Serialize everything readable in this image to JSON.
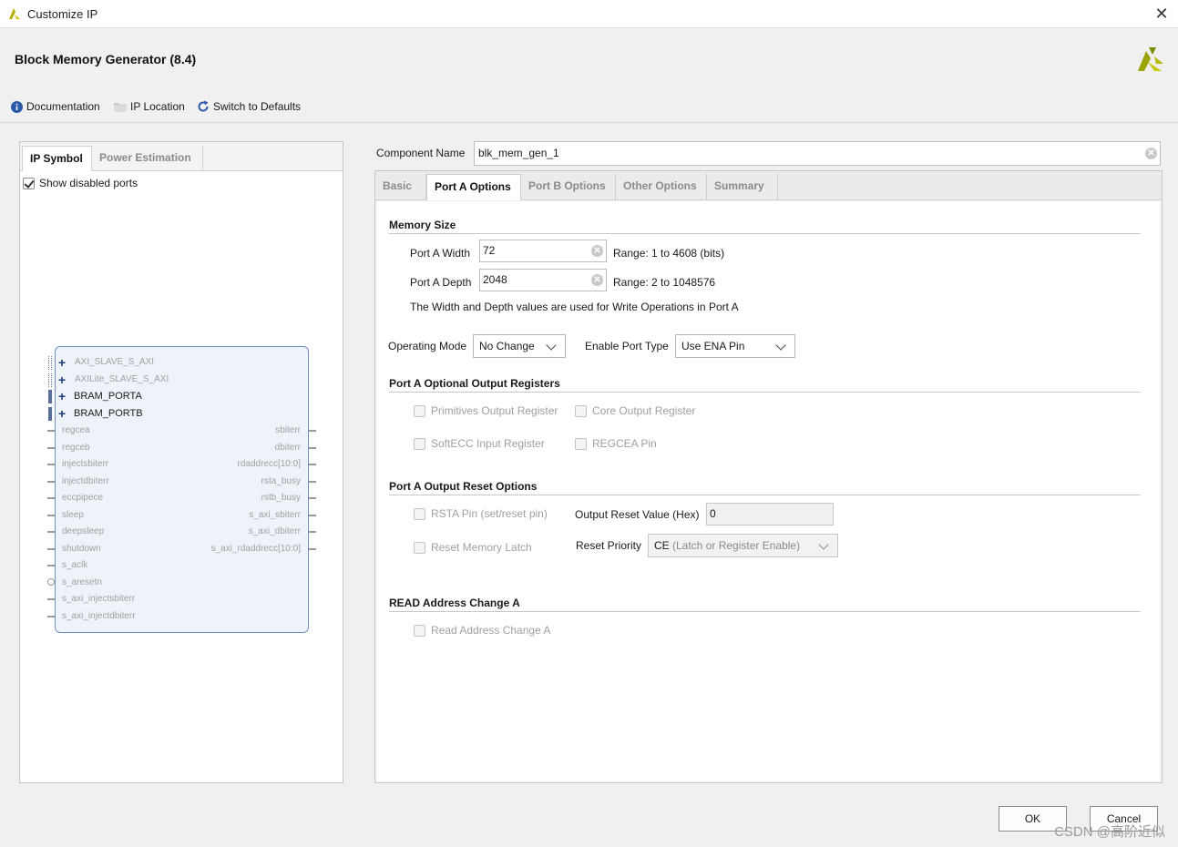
{
  "window": {
    "title": "Customize IP"
  },
  "header": {
    "ip_title": "Block Memory Generator (8.4)",
    "links": {
      "documentation": "Documentation",
      "ip_location": "IP Location",
      "switch_defaults": "Switch to Defaults"
    }
  },
  "left": {
    "tabs": [
      "IP Symbol",
      "Power Estimation"
    ],
    "show_disabled_ports": "Show disabled ports",
    "bus_ports": [
      "AXI_SLAVE_S_AXI",
      "AXILite_SLAVE_S_AXI",
      "BRAM_PORTA",
      "BRAM_PORTB"
    ],
    "left_ports": [
      "regcea",
      "regceb",
      "injectsbiterr",
      "injectdbiterr",
      "eccpipece",
      "sleep",
      "deepsleep",
      "shutdown",
      "s_aclk",
      "s_aresetn",
      "s_axi_injectsbiterr",
      "s_axi_injectdbiterr"
    ],
    "right_ports": [
      "sbiterr",
      "dbiterr",
      "rdaddrecc[10:0]",
      "rsta_busy",
      "rstb_busy",
      "s_axi_sbiterr",
      "s_axi_dbiterr",
      "s_axi_rdaddrecc[10:0]"
    ]
  },
  "component": {
    "label": "Component Name",
    "value": "blk_mem_gen_1"
  },
  "tabs": [
    "Basic",
    "Port A Options",
    "Port B Options",
    "Other Options",
    "Summary"
  ],
  "memory_size": {
    "title": "Memory Size",
    "width_label": "Port A Width",
    "width_value": "72",
    "width_range": "Range: 1 to 4608 (bits)",
    "depth_label": "Port A Depth",
    "depth_value": "2048",
    "depth_range": "Range: 2 to 1048576",
    "note": "The Width and Depth values are used for Write Operations in Port A"
  },
  "mode": {
    "op_label": "Operating Mode",
    "op_value": "No Change",
    "enable_label": "Enable Port Type",
    "enable_value": "Use ENA Pin"
  },
  "output_regs": {
    "title": "Port A Optional Output Registers",
    "primitives": "Primitives Output Register",
    "core": "Core Output Register",
    "softecc": "SoftECC Input Register",
    "regcea": "REGCEA Pin"
  },
  "reset": {
    "title": "Port A Output Reset Options",
    "rsta": "RSTA Pin (set/reset pin)",
    "reset_value_label": "Output Reset Value (Hex)",
    "reset_value": "0",
    "reset_latch": "Reset Memory Latch",
    "priority_label": "Reset Priority",
    "priority_prefix": "CE",
    "priority_rest": " (Latch or Register Enable)"
  },
  "read_addr": {
    "title": "READ Address Change A",
    "option": "Read Address Change A"
  },
  "footer": {
    "ok": "OK",
    "cancel": "Cancel"
  },
  "watermark": "CSDN @高阶近似"
}
